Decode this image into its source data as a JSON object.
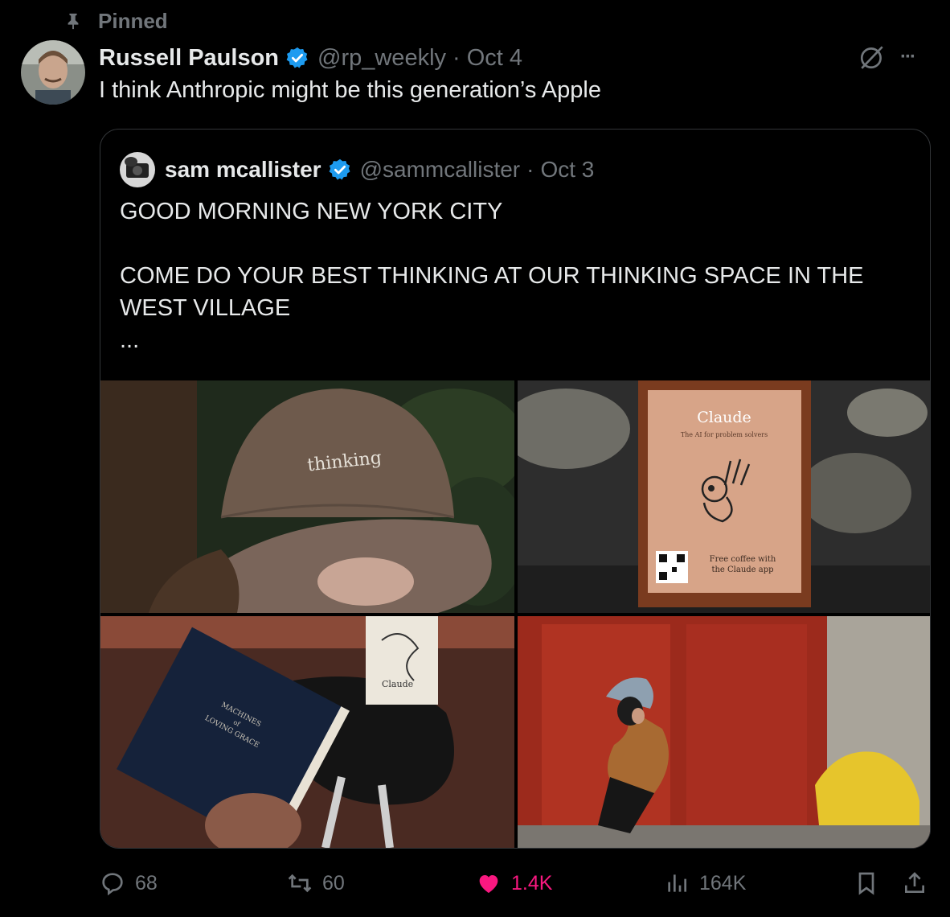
{
  "pinned_label": "Pinned",
  "tweet": {
    "author_name": "Russell Paulson",
    "handle": "@rp_weekly",
    "separator": "·",
    "date": "Oct 4",
    "text": "I think Anthropic might be this generation’s Apple",
    "more_label": "···"
  },
  "quote": {
    "author_name": "sam mcallister",
    "handle": "@sammcallister",
    "separator": "·",
    "date": "Oct 3",
    "line1": "GOOD MORNING NEW YORK CITY",
    "line2": "COME DO YOUR BEST THINKING AT OUR THINKING SPACE IN THE WEST VILLAGE",
    "ellipsis": "...",
    "photos": {
      "cap_text": "thinking",
      "sign_title": "Claude",
      "sign_subtitle": "The AI for problem solvers",
      "sign_footer_1": "Free coffee with",
      "sign_footer_2": "the Claude app",
      "book_title_1": "MACHINES",
      "book_title_2": "of",
      "book_title_3": "LOVING GRACE",
      "cup_text": "Claude"
    }
  },
  "actions": {
    "replies": "68",
    "reposts": "60",
    "likes": "1.4K",
    "views": "164K"
  },
  "colors": {
    "background": "#000000",
    "text": "#e7e9ea",
    "muted": "#71767b",
    "verified": "#1d9bf0",
    "like": "#f91880",
    "border": "#333639"
  }
}
